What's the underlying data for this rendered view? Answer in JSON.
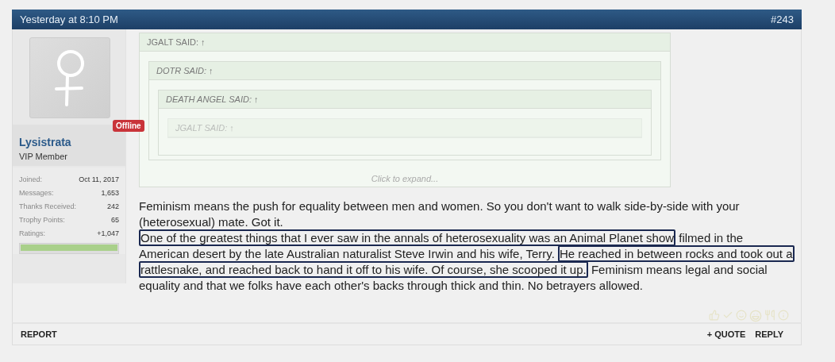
{
  "post": {
    "time": "Yesterday at 8:10 PM",
    "number": "#243"
  },
  "user": {
    "name": "Lysistrata",
    "title": "VIP Member",
    "status": "Offline",
    "online": false,
    "stats": [
      {
        "label": "Joined:",
        "value": "Oct 11, 2017"
      },
      {
        "label": "Messages:",
        "value": "1,653"
      },
      {
        "label": "Thanks Received:",
        "value": "242"
      },
      {
        "label": "Trophy Points:",
        "value": "65"
      },
      {
        "label": "Ratings:",
        "value": "+1,047"
      }
    ],
    "rating_bar": {
      "level": 1
    }
  },
  "quote": {
    "author": "JGALT SAID:",
    "arrow": "↑",
    "italic": false,
    "children": [
      {
        "author": "DOTR SAID:",
        "arrow": "↑",
        "italic": true,
        "children": [
          {
            "author": "DEATH ANGEL SAID:",
            "arrow": "↑",
            "italic": true,
            "children": [
              {
                "author": "JGALT SAID:",
                "arrow": "↑",
                "italic": true
              }
            ]
          }
        ]
      }
    ],
    "expand": "Click to expand..."
  },
  "body": [
    {
      "segments": [
        {
          "text": "Feminism means the push for equality between men and women. So you don't want to walk side-by-side with your (heterosexual) mate. Got it.",
          "highlighted": false
        }
      ]
    },
    {
      "segments": [
        {
          "text": "One of the greatest things that I ever saw in the annals of heterosexuality was an Animal Planet show",
          "highlighted": true
        },
        {
          "text": " filmed in the American desert by the late Australian naturalist Steve Irwin and his wife, Terry. ",
          "highlighted": false
        },
        {
          "text": "He reached in between rocks and took out a rattlesnake, and reached back to hand it off to his wife. Of course, she scooped it up.",
          "highlighted": true
        },
        {
          "text": " Feminism means legal and social equality and that we folks have each other's backs through thick and thin. No betrayers allowed.",
          "highlighted": false
        }
      ]
    }
  ],
  "footer": {
    "left": [
      "REPORT"
    ],
    "right": [
      "+ QUOTE",
      "REPLY"
    ]
  }
}
